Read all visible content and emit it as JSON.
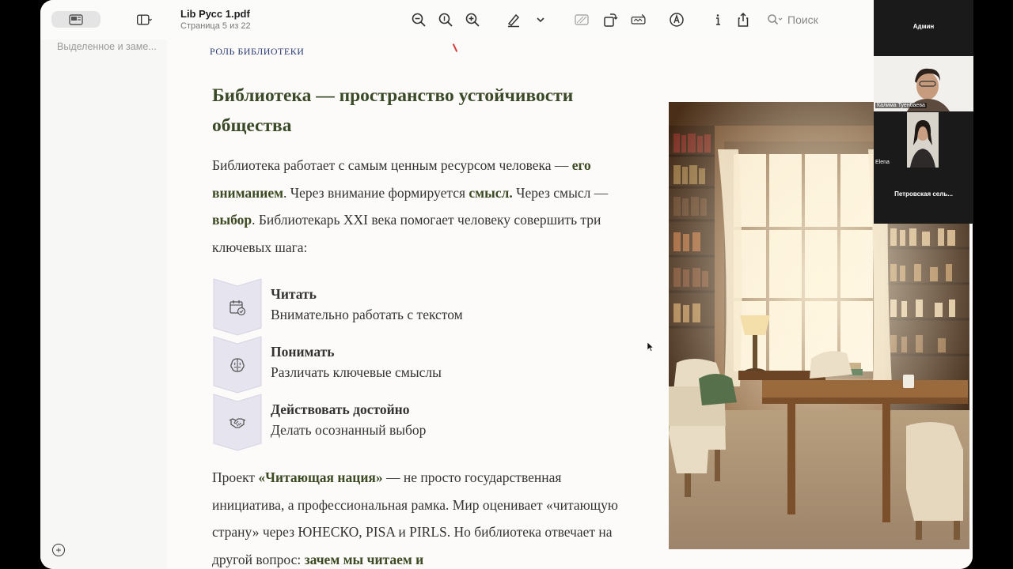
{
  "window": {
    "title": "Lib Русс 1.pdf",
    "subtitle": "Страница 5 из 22"
  },
  "toolbar": {
    "icons": [
      "sidebar-icon",
      "zoom-out-icon",
      "zoom-in-icon",
      "zoom-in-plus-icon",
      "highlighter-icon",
      "chevron-down-icon",
      "redact-icon",
      "rotate-icon",
      "markup-icon",
      "annotate-icon",
      "info-icon",
      "share-icon"
    ],
    "search_placeholder": "Поиск"
  },
  "sidebar": {
    "heading": "Выделенное и заме..."
  },
  "page": {
    "section_label": "РОЛЬ БИБЛИОТЕКИ",
    "heading": "Библиотека — пространство устойчивости общества",
    "p1": {
      "t1": "Библиотека работает с самым ценным ресурсом человека — ",
      "b1": "его вниманием",
      "t2": ". Через внимание формируется ",
      "b2": "смысл.",
      "t3": " Через смысл — ",
      "b3": "выбор",
      "t4": ". Библиотекарь XXI века помогает человеку совершить три ключевых шага:"
    },
    "steps": [
      {
        "title": "Читать",
        "desc": "Внимательно работать с текстом",
        "icon": "calendar-check-icon"
      },
      {
        "title": "Понимать",
        "desc": "Различать ключевые смыслы",
        "icon": "brain-icon"
      },
      {
        "title": "Действовать достойно",
        "desc": "Делать осознанный выбор",
        "icon": "handshake-icon"
      }
    ],
    "p2": {
      "t1": "Проект ",
      "b1": "«Читающая нация»",
      "t2": " — не просто государственная инициатива, а профессиональная рамка. Мир оценивает «читающую страну» через ЮНЕСКО, PISA и PIRLS. Но библиотека отвечает на другой вопрос: ",
      "b2": "зачем мы читаем и"
    }
  },
  "video": {
    "admin": "Админ",
    "participant1": "Калима Туенбаева",
    "participant2": "Elena",
    "participant3": "Петровская сель..."
  },
  "colors": {
    "heading": "#3a4a28",
    "accent_bold": "#3b4a22",
    "section_label": "#2a3a74",
    "chevron_fill": "#e6e4ee"
  }
}
